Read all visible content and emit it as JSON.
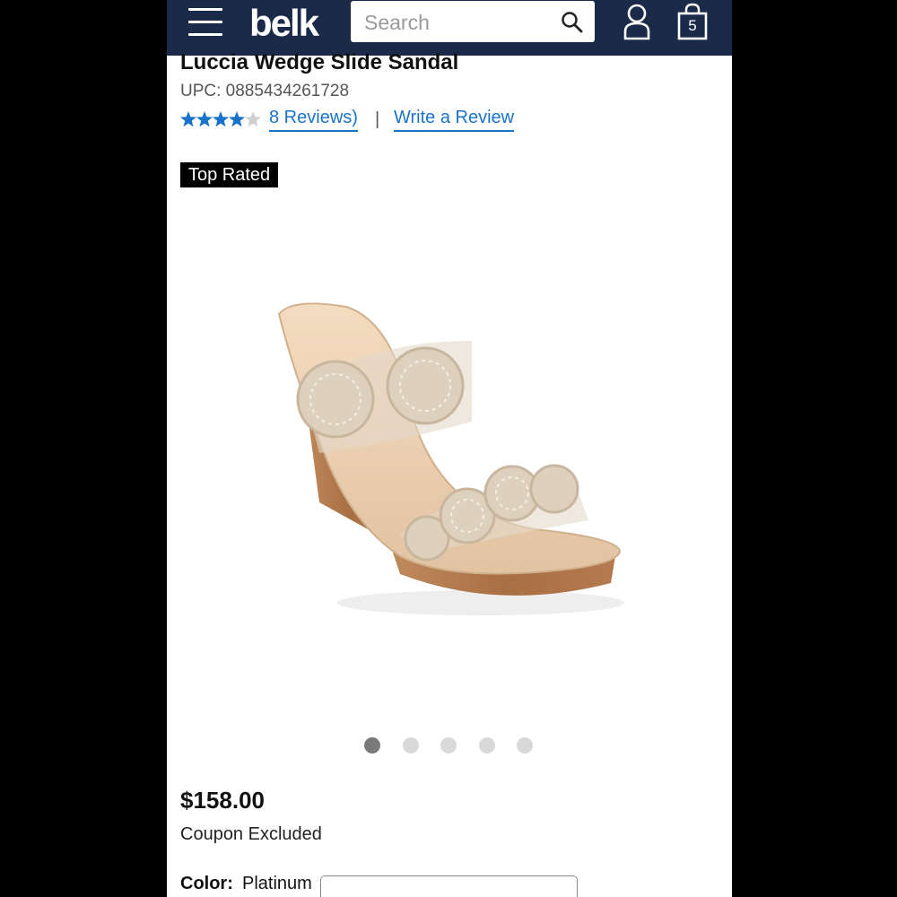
{
  "header": {
    "logo": "belk",
    "search_placeholder": "Search",
    "bag_count": "5",
    "icons": [
      "menu-icon",
      "search-icon",
      "account-icon",
      "shopping-bag-icon"
    ],
    "background_color": "#1c2a4a"
  },
  "product": {
    "title": "Luccia Wedge Slide Sandal",
    "upc": "UPC: 0885434261728",
    "rating": 4.5,
    "reviews_label": "8 Reviews)",
    "separator": "|",
    "write_review_label": "Write a Review",
    "badge": "Top Rated",
    "image_count": 5,
    "active_image": 1,
    "price": "$158.00",
    "coupon_note": "Coupon Excluded",
    "color_label": "Color:",
    "color_value": "Platinum"
  },
  "colors": {
    "link": "#1a73c8",
    "star": "#1a73c8"
  }
}
